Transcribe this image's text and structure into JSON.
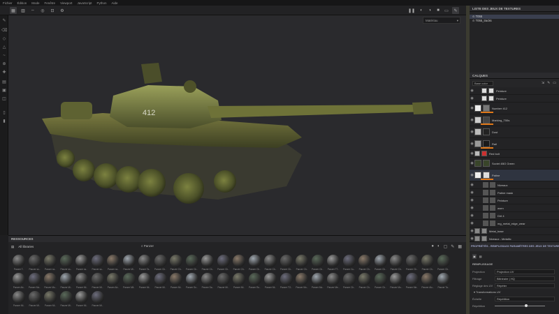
{
  "menu": [
    "Fichier",
    "Édition",
    "Mode",
    "Fenêtre",
    "Viewport",
    "JavaScript",
    "Python",
    "Aide"
  ],
  "viewport": {
    "select_value": "Matériau"
  },
  "texture_sets": {
    "title": "LISTE DES JEUX DE TEXTURES",
    "items": [
      "T055",
      "T055_tracks"
    ]
  },
  "layers": {
    "title": "CALQUES",
    "blend": "Base color",
    "items": [
      {
        "name": "Peinture",
        "kind": "small",
        "thumb": "#ddd",
        "mask": "#ddd",
        "bar": false
      },
      {
        "name": "Peinture",
        "kind": "small",
        "thumb": "#ddd",
        "mask": "#ddd",
        "bar": false
      },
      {
        "name": "Number 412",
        "kind": "big",
        "thumb": "#eee",
        "mask": "#777",
        "bar": true
      },
      {
        "name": "Marking_T55s",
        "kind": "big",
        "thumb": "#ccc",
        "mask": "#444",
        "bar": true
      },
      {
        "name": "Dust",
        "kind": "big",
        "thumb": "#bbb",
        "mask": "#222",
        "bar": false
      },
      {
        "name": "Rail",
        "kind": "big",
        "thumb": "#999",
        "mask": "#1a1a1a",
        "bar": true
      },
      {
        "name": "Red bolt",
        "kind": "small",
        "thumb": "#bbb",
        "mask": "#cc3030",
        "bar": false
      },
      {
        "name": "Soviet 4BO Green",
        "kind": "big",
        "thumb": "#39452a",
        "mask": "#39452a",
        "bar": false
      },
      {
        "name": "Patine",
        "kind": "big",
        "thumb": "#eee",
        "mask": "#ddd",
        "bar": true
      },
      {
        "name": "Niveaux",
        "kind": "small",
        "thumb": "#555",
        "mask": "#555",
        "bar": false
      },
      {
        "name": "Patine mask",
        "kind": "small",
        "thumb": "#555",
        "mask": "#555",
        "bar": false
      },
      {
        "name": "Peinture",
        "kind": "small",
        "thumb": "#555",
        "mask": "#555",
        "bar": false
      },
      {
        "name": "worn",
        "kind": "small",
        "thumb": "#555",
        "mask": "#555",
        "bar": false
      },
      {
        "name": "Dirt 4",
        "kind": "small",
        "thumb": "#555",
        "mask": "#555",
        "bar": false
      },
      {
        "name": "mg_metal_edge_wear",
        "kind": "small",
        "thumb": "#555",
        "mask": "#555",
        "bar": false
      },
      {
        "name": "Metal_base",
        "kind": "small",
        "thumb": "#888",
        "mask": "#888",
        "bar": false
      },
      {
        "name": "Niveaux - Metallic",
        "kind": "small",
        "thumb": "#888",
        "mask": "#888",
        "bar": false
      }
    ]
  },
  "properties": {
    "tab1": "PROPRIÉTÉS - REMPLISSAGE",
    "tab2": "PARAMÈTRES DES JEUX DE TEXTURES",
    "section": "REMPLISSAGE",
    "rows": [
      {
        "k": "Projection",
        "v": "Projection UV"
      },
      {
        "k": "Filtrage",
        "v": "Bilinéaire | HQ"
      },
      {
        "k": "Réglage des UV",
        "v": "Répéter"
      }
    ],
    "subsection": "Transformations UV",
    "scale_label": "Échelle",
    "scale_value": "Répétition",
    "repeat_label": "Répétition"
  },
  "resources": {
    "title": "RESSOURCES",
    "library": "All libraries",
    "search": "Panzer",
    "materials": [
      "Panzer T..",
      "Panzer ss..",
      "Panzer ss..",
      "Panzer ss..",
      "Panzer ss..",
      "Panzer ss..",
      "Panzer ss..",
      "Panzer Mi..",
      "Panzer Ta..",
      "Panzer Ch..",
      "Panzer Ch..",
      "Panzer Ch..",
      "Panzer Ch..",
      "Panzer Ch..",
      "Panzer Ch..",
      "Panzer Ch..",
      "Panzer Ch..",
      "Panzer Ch..",
      "Panzer Ch..",
      "Panzer Ch..",
      "Panzer T7..",
      "Panzer Cu..",
      "Panzer Ch..",
      "Panzer Ch..",
      "Panzer Ch..",
      "Panzer Ch..",
      "Panzer Ch..",
      "Panzer Ch..",
      "Panzer Ab..",
      "Panzer Mo..",
      "Panzer Mo..",
      "Panzer Mi..",
      "Panzer Mi..",
      "Panzer Mi..",
      "Panzer Ab..",
      "Panzer Mil..",
      "Panzer Mi..",
      "Panzer Mi..",
      "Panzer Mi..",
      "Panzer Sn..",
      "Panzer Sa..",
      "Panzer Mi..",
      "Panzer Mi..",
      "Panzer Ro..",
      "Panzer Mi..",
      "Panzer TO..",
      "Panzer Mo..",
      "Panzer Mo..",
      "Panzer Me..",
      "Panzer Ch..",
      "Panzer Ch..",
      "Panzer Ch..",
      "Panzer Mo..",
      "Panzer Me..",
      "Panzer Alu..",
      "Panzer Ta..",
      "Panzer Mi..",
      "Panzer Mi..",
      "Panzer Mi..",
      "Panzer Mi..",
      "Panzer Mi..",
      "Panzer Mi.."
    ]
  }
}
